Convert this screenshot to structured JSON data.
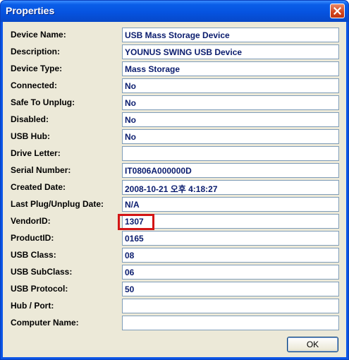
{
  "window": {
    "title": "Properties"
  },
  "fields": [
    {
      "label": "Device Name:",
      "value": "USB Mass Storage Device"
    },
    {
      "label": "Description:",
      "value": "YOUNUS SWING USB Device"
    },
    {
      "label": "Device Type:",
      "value": "Mass Storage"
    },
    {
      "label": "Connected:",
      "value": "No"
    },
    {
      "label": "Safe To Unplug:",
      "value": "No"
    },
    {
      "label": "Disabled:",
      "value": "No"
    },
    {
      "label": "USB Hub:",
      "value": "No"
    },
    {
      "label": "Drive Letter:",
      "value": ""
    },
    {
      "label": "Serial Number:",
      "value": "IT0806A000000D"
    },
    {
      "label": "Created Date:",
      "value": "2008-10-21 오후 4:18:27"
    },
    {
      "label": "Last Plug/Unplug Date:",
      "value": "N/A"
    },
    {
      "label": "VendorID:",
      "value": "1307"
    },
    {
      "label": "ProductID:",
      "value": "0165"
    },
    {
      "label": "USB Class:",
      "value": "08"
    },
    {
      "label": "USB SubClass:",
      "value": "06"
    },
    {
      "label": "USB Protocol:",
      "value": "50"
    },
    {
      "label": "Hub / Port:",
      "value": ""
    },
    {
      "label": "Computer Name:",
      "value": ""
    }
  ],
  "buttons": {
    "ok": "OK"
  },
  "colors": {
    "title_bar": "#0653e0",
    "value_text": "#0a1c6e",
    "highlight": "#d31515"
  }
}
